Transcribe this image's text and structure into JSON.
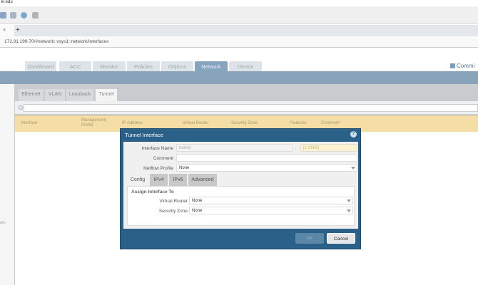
{
  "browser": {
    "domain_fragment": "er.edu",
    "tab_close": "×",
    "new_tab": "+",
    "url": "172.31.199.70/#network::vsys1::network/interfaces"
  },
  "nav": {
    "tabs": [
      "Dashboard",
      "ACC",
      "Monitor",
      "Policies",
      "Objects",
      "Network",
      "Device"
    ],
    "active": "Network",
    "commit": "Commi"
  },
  "left_panel": {
    "fragment": "nfo"
  },
  "subtabs": {
    "items": [
      "Ethernet",
      "VLAN",
      "Loopback",
      "Tunnel"
    ],
    "active": "Tunnel"
  },
  "table": {
    "headers": [
      "Interface",
      "Management Profile",
      "IP Address",
      "Virtual Router",
      "Security Zone",
      "Features",
      "Comment"
    ]
  },
  "dialog": {
    "title": "Tunnel Interface",
    "help": "?",
    "interface_name_label": "Interface Name",
    "interface_name_value": "tunnel",
    "dot": ".",
    "suffix_placeholder": "[1-9999]",
    "comment_label": "Comment",
    "comment_value": "",
    "netflow_label": "Netflow Profile",
    "netflow_value": "None",
    "tabs": [
      "Config",
      "IPv4",
      "IPv6",
      "Advanced"
    ],
    "active_tab": "Config",
    "assign_legend": "Assign Interface To",
    "virtual_router_label": "Virtual Router",
    "virtual_router_value": "None",
    "security_zone_label": "Security Zone",
    "security_zone_value": "None",
    "ok": "OK",
    "cancel": "Cancel"
  },
  "colors": {
    "accent": "#2b6088",
    "header_band": "#89a4ba",
    "table_header": "#f4dea6"
  }
}
